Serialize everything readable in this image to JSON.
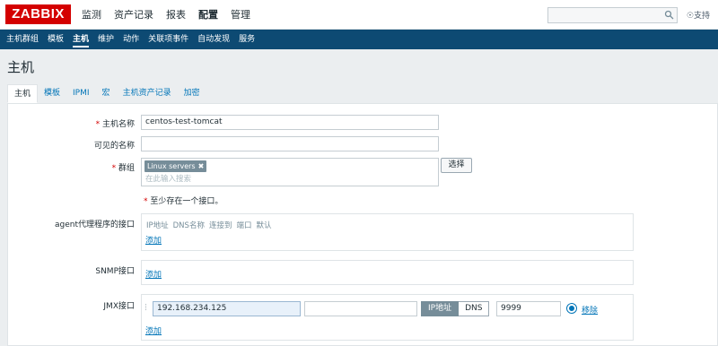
{
  "header": {
    "logo": "ZABBIX",
    "menu": [
      "监测",
      "资产记录",
      "报表",
      "配置",
      "管理"
    ],
    "support": "支持"
  },
  "subnav": [
    "主机群组",
    "模板",
    "主机",
    "维护",
    "动作",
    "关联项事件",
    "自动发现",
    "服务"
  ],
  "page_title": "主机",
  "tabs": [
    "主机",
    "模板",
    "IPMI",
    "宏",
    "主机资产记录",
    "加密"
  ],
  "form": {
    "host_name_label": "主机名称",
    "host_name_value": "centos-test-tomcat",
    "visible_name_label": "可见的名称",
    "visible_name_value": "",
    "groups_label": "群组",
    "group_chip": "Linux servers",
    "groups_placeholder": "在此输入搜索",
    "select_button": "选择",
    "interface_note": "至少存在一个接口。",
    "agent_label": "agent代理程序的接口",
    "agent_columns": [
      "IP地址",
      "DNS名称",
      "连接到",
      "端口",
      "默认"
    ],
    "add_link": "添加",
    "snmp_label": "SNMP接口",
    "jmx_label": "JMX接口",
    "jmx_ip": "192.168.234.125",
    "jmx_dns": "",
    "jmx_ip_toggle": "IP地址",
    "jmx_dns_toggle": "DNS",
    "jmx_port": "9999",
    "remove_link": "移除"
  },
  "colors": {
    "brand": "#d40000",
    "subnav_bg": "#0d4a73",
    "link": "#0275b8"
  }
}
